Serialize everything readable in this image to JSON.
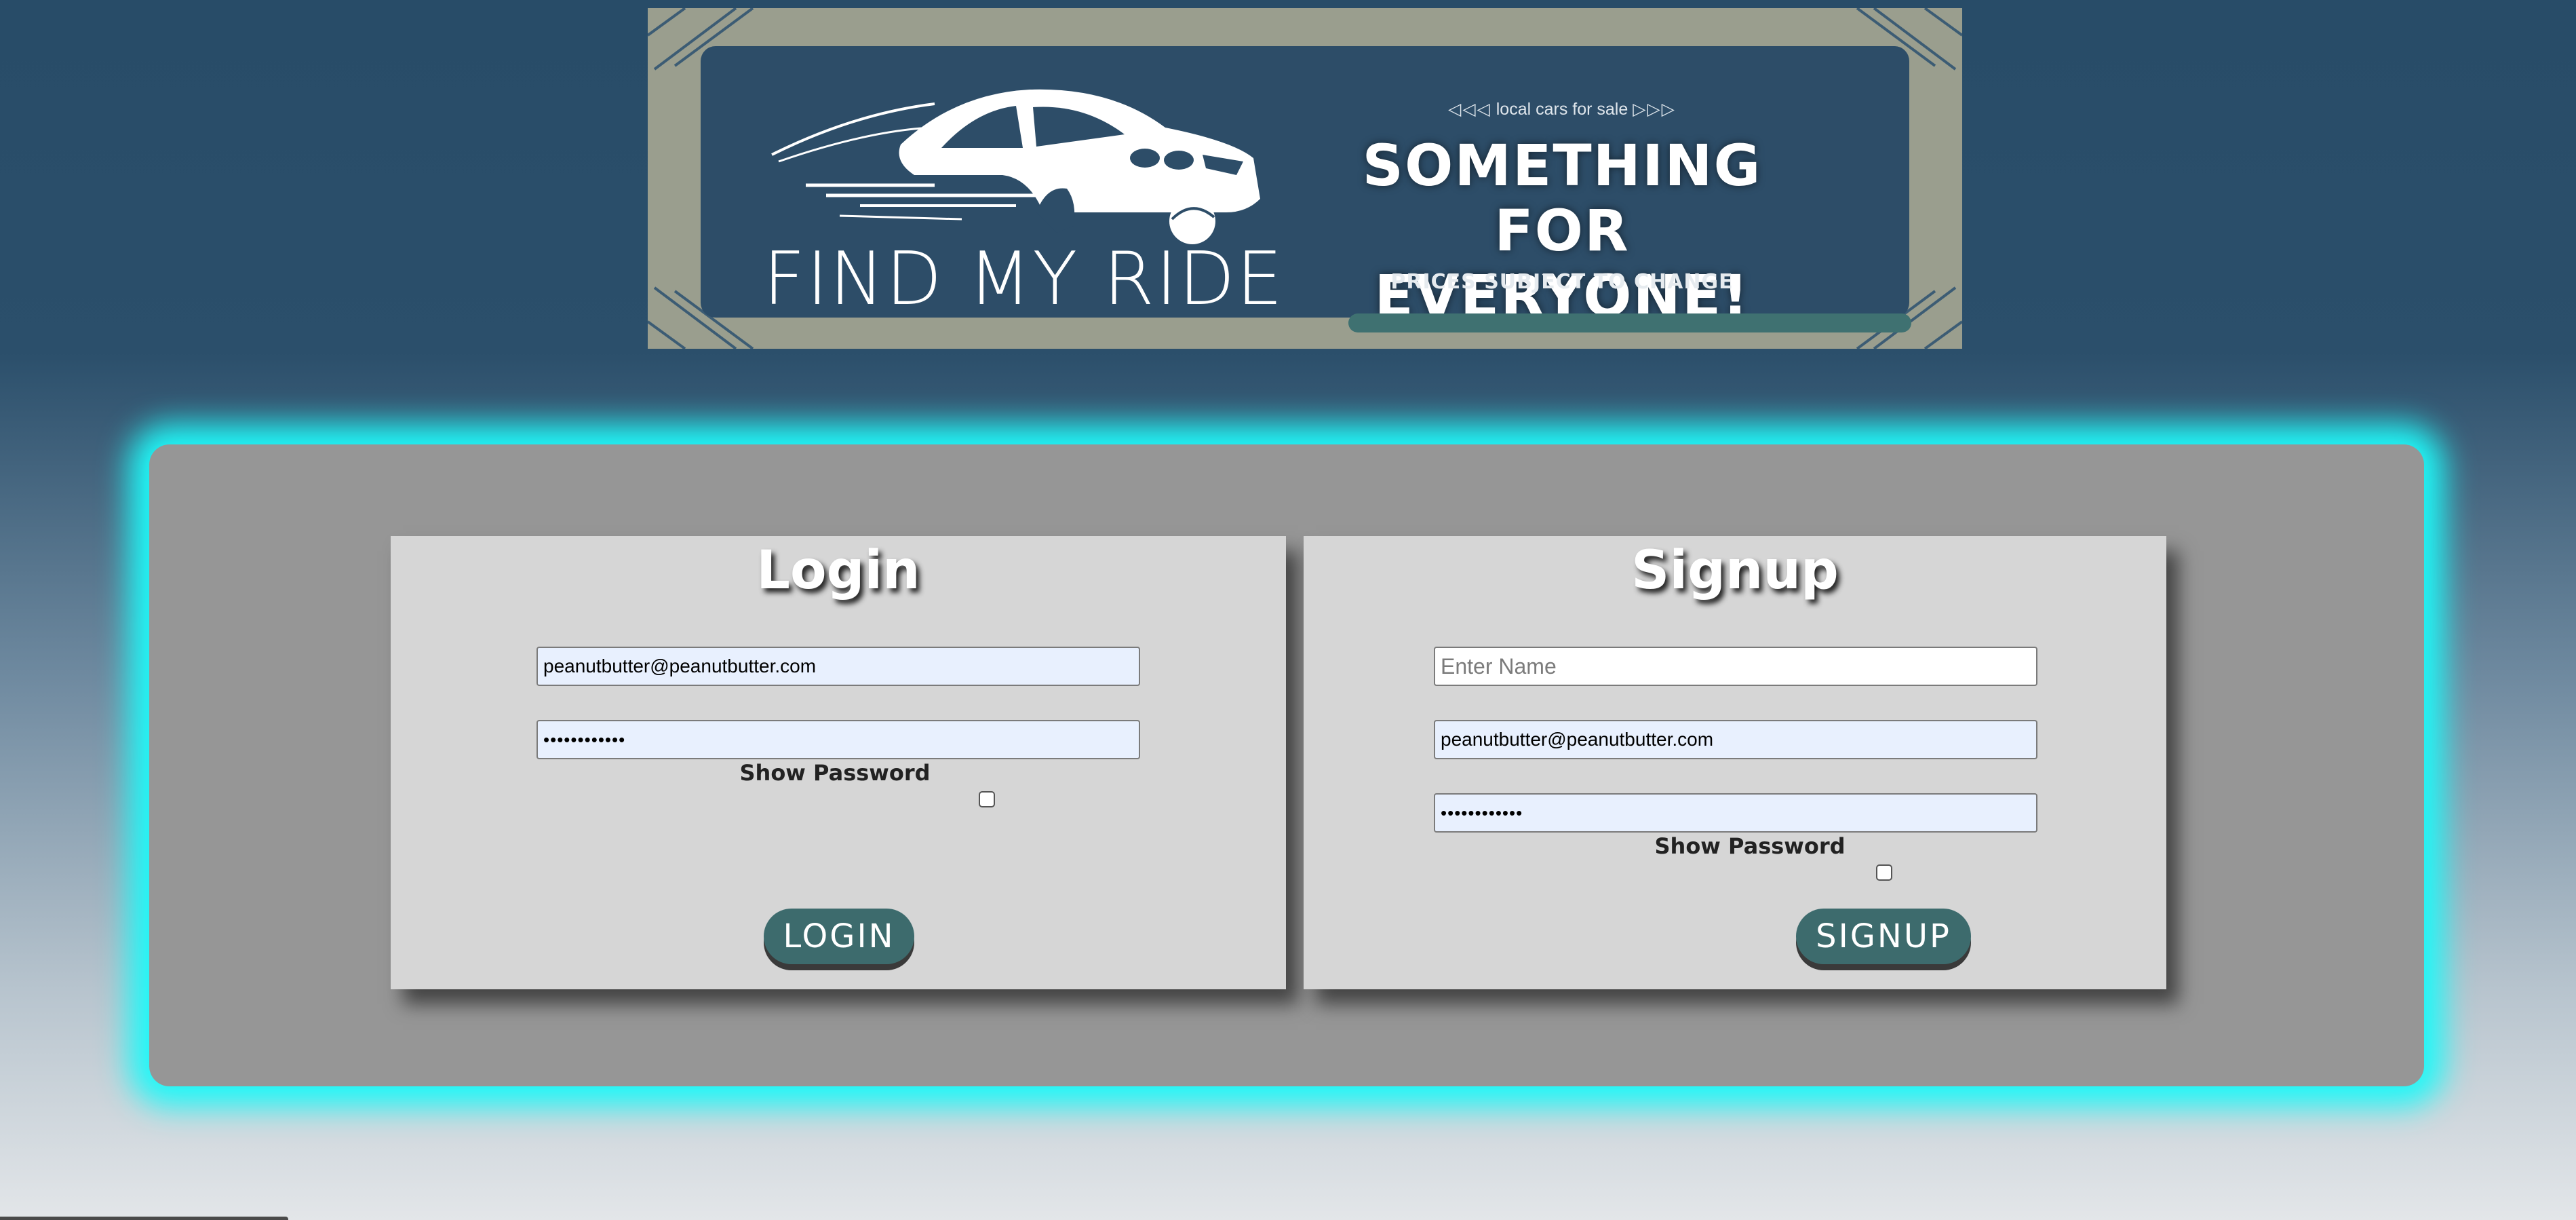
{
  "banner": {
    "tagline_small": "local cars for sale",
    "tagline_arrows_left": "◁◁◁",
    "tagline_arrows_right": "▷▷▷",
    "brand": "FIND MY RIDE",
    "headline_line1": "SOMETHING FOR",
    "headline_line2": "EVERYONE!",
    "subline": "PRICES SUBJECT TO CHANGE",
    "icon": "car-icon"
  },
  "login": {
    "title": "Login",
    "email_value": "peanutbutter@peanutbutter.com",
    "password_value": "••••••••••••",
    "show_password_label": "Show Password",
    "show_password_checked": false,
    "button_label": "LOGIN"
  },
  "signup": {
    "title": "Signup",
    "name_placeholder": "Enter Name",
    "name_value": "",
    "email_value": "peanutbutter@peanutbutter.com",
    "password_value": "••••••••••••",
    "show_password_label": "Show Password",
    "show_password_checked": false,
    "button_label": "SIGNUP"
  },
  "colors": {
    "background_top": "#284c68",
    "banner_frame": "#9a9e8e",
    "banner_inner": "#2d4d68",
    "panel": "#969696",
    "panel_glow": "#1ff8f8",
    "card": "#d6d6d6",
    "button": "#3d6b6d",
    "autofill_field": "#e8f0fe"
  }
}
